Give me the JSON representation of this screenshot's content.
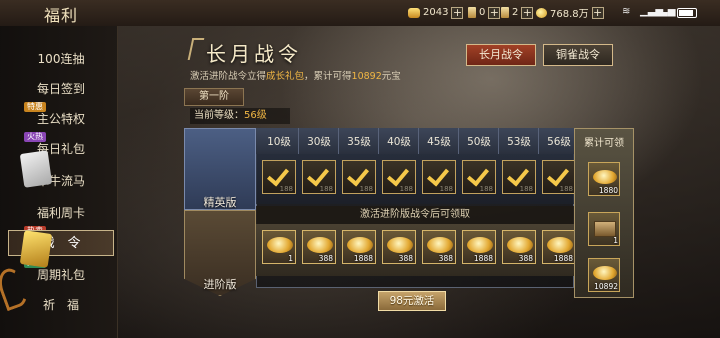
{
  "app": {
    "title": "福利"
  },
  "status_bar": {
    "tokens_1": "2043",
    "tokens_2": "0",
    "tokens_3": "2",
    "yuanbao": "768.8万",
    "time": "",
    "icons": [
      "wifi-icon",
      "signal-icon",
      "battery-icon"
    ]
  },
  "sidebar": {
    "items": [
      {
        "label": "100连抽",
        "tag": ""
      },
      {
        "label": "每日签到",
        "tag": ""
      },
      {
        "label": "主公特权",
        "tag": "特惠"
      },
      {
        "label": "每日礼包",
        "tag": "火热"
      },
      {
        "label": "木牛流马",
        "tag": ""
      },
      {
        "label": "福利周卡",
        "tag": ""
      },
      {
        "label": "战　令",
        "tag": "热卖"
      },
      {
        "label": "周期礼包",
        "tag": "火爆"
      },
      {
        "label": "祈　福",
        "tag": ""
      }
    ],
    "active_index": 6
  },
  "header": {
    "title": "长月战令",
    "desc_prefix": "激活进阶战令立得",
    "desc_highlight": "成长礼包",
    "desc_middle": "，累计可得",
    "desc_amount": "10892",
    "desc_suffix": "元宝"
  },
  "tabs": [
    "长月战令",
    "铜雀战令"
  ],
  "tier": {
    "label": "第一阶"
  },
  "current_level": {
    "label": "当前等级：",
    "value": "56级"
  },
  "levels": [
    "10级",
    "30级",
    "35级",
    "40级",
    "45级",
    "50级",
    "53级",
    "56级"
  ],
  "tracks": {
    "free": {
      "label": "精英版",
      "rewards": [
        "188",
        "188",
        "188",
        "188",
        "188",
        "188",
        "188",
        "188"
      ]
    },
    "advanced": {
      "label": "进阶版",
      "locked_notice": "激活进阶版战令后可领取",
      "rewards": [
        "1",
        "388",
        "1888",
        "388",
        "388",
        "1888",
        "388",
        "1888"
      ]
    }
  },
  "cumulative": {
    "title": "累计可领",
    "free_total": "1880",
    "chest_count": "1",
    "adv_total": "10892"
  },
  "activate_button": {
    "label": "98元激活"
  },
  "colors": {
    "accent_gold": "#f0b644",
    "active_tab": "#a24126",
    "free_track": "#4c5f84"
  }
}
